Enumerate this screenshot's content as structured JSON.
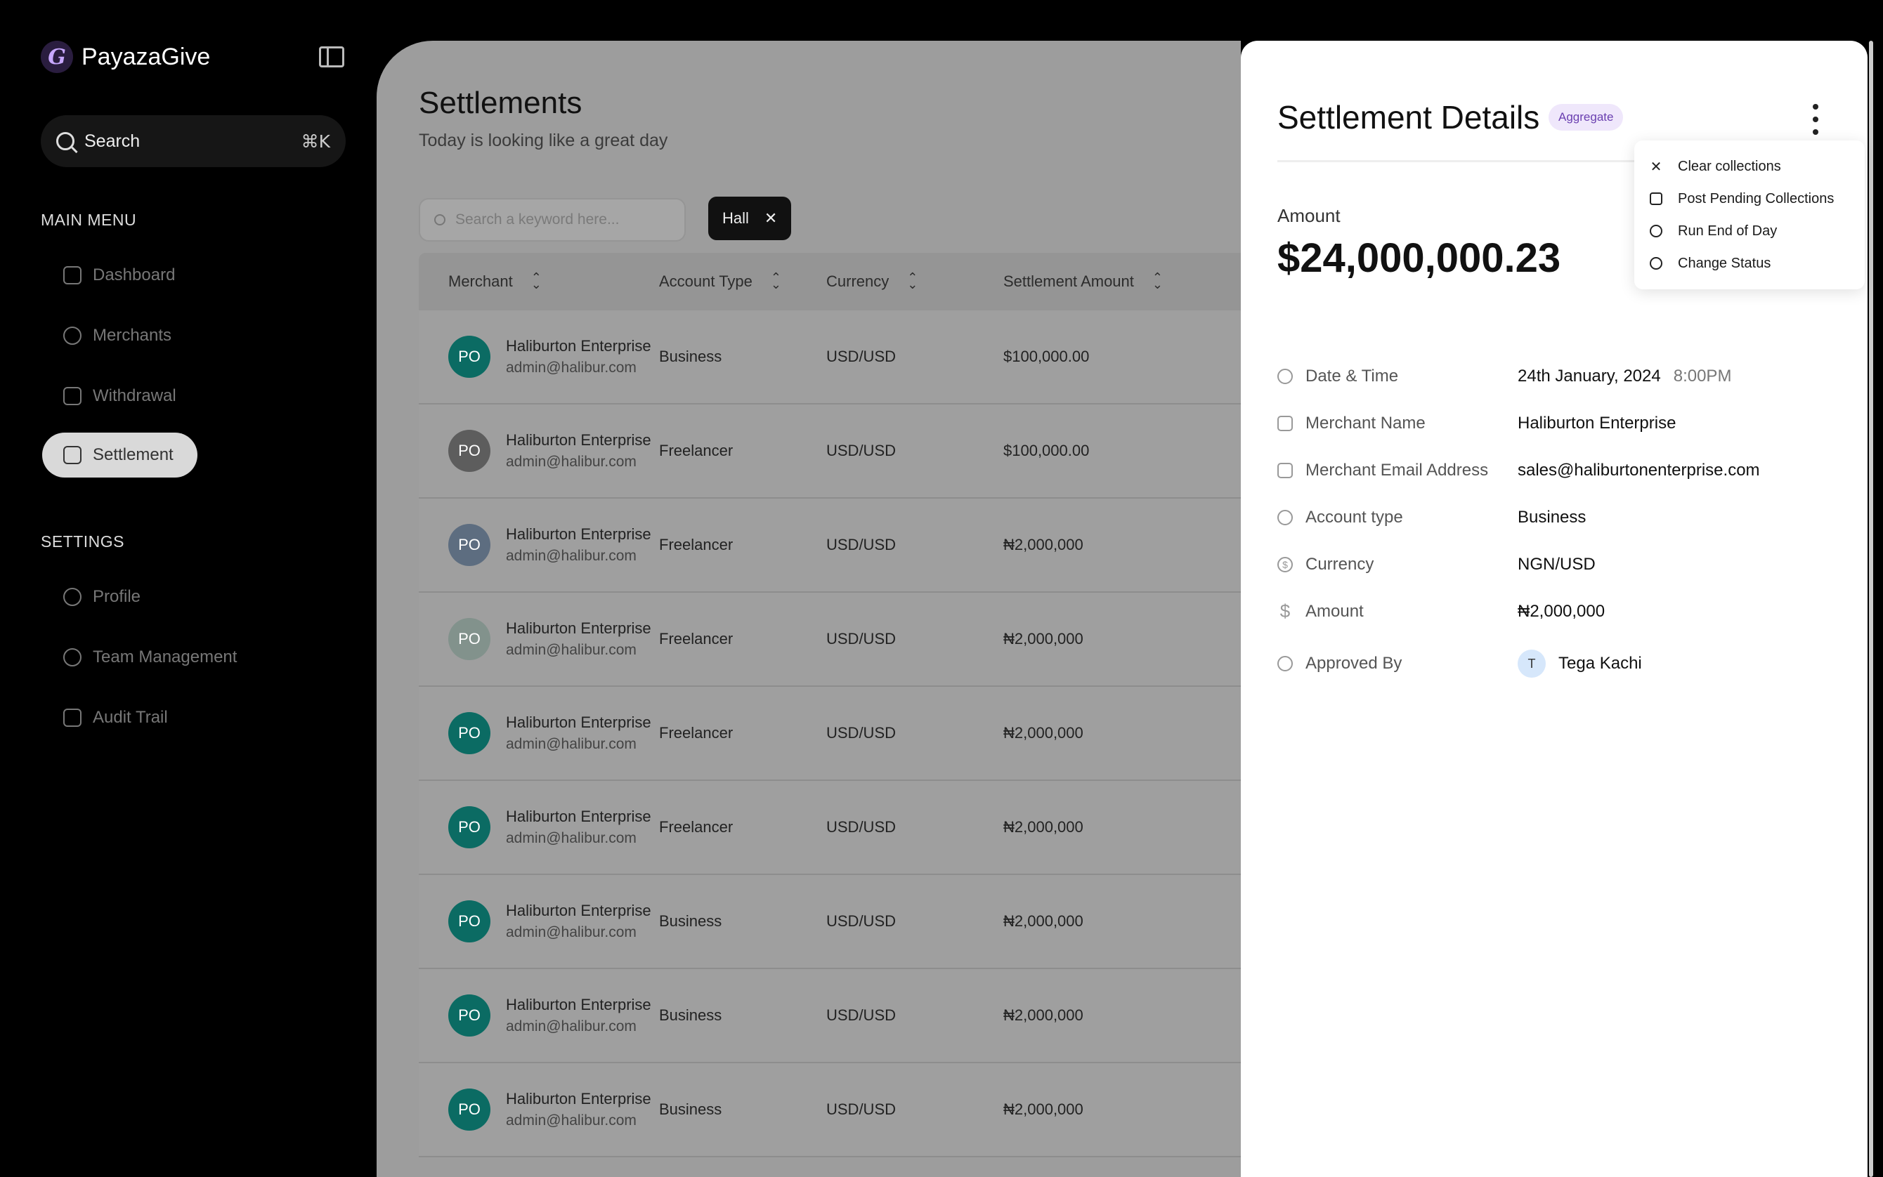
{
  "brand": {
    "name": "PayazaGive",
    "logo_letter": "G"
  },
  "sidebar": {
    "search_label": "Search",
    "search_shortcut": "⌘K",
    "main_menu_title": "MAIN MENU",
    "main_items": [
      {
        "label": "Dashboard",
        "icon": "grid-icon"
      },
      {
        "label": "Merchants",
        "icon": "users-icon"
      },
      {
        "label": "Withdrawal",
        "icon": "wallet-icon"
      },
      {
        "label": "Settlement",
        "icon": "settlement-icon",
        "active": true
      }
    ],
    "settings_title": "SETTINGS",
    "settings_items": [
      {
        "label": "Profile",
        "icon": "user-icon"
      },
      {
        "label": "Team Management",
        "icon": "team-icon"
      },
      {
        "label": "Audit Trail",
        "icon": "audit-icon"
      }
    ]
  },
  "main": {
    "title": "Settlements",
    "subtitle": "Today is looking like a great day",
    "search_placeholder": "Search a keyword here...",
    "filter_chip": "Hall",
    "columns": [
      "Merchant",
      "Account Type",
      "Currency",
      "Settlement Amount"
    ],
    "rows": [
      {
        "initials": "PO",
        "avatar_color": "#0b6b63",
        "name": "Haliburton Enterprise",
        "email": "admin@halibur.com",
        "type": "Business",
        "currency": "USD/USD",
        "amount": "$100,000.00",
        "status_color": "#8e8e8e"
      },
      {
        "initials": "PO",
        "avatar_color": "#5d5d5d",
        "name": "Haliburton Enterprise",
        "email": "admin@halibur.com",
        "type": "Freelancer",
        "currency": "USD/USD",
        "amount": "$100,000.00",
        "status_color": "#a89570"
      },
      {
        "initials": "PO",
        "avatar_color": "#5d6d80",
        "name": "Haliburton Enterprise",
        "email": "admin@halibur.com",
        "type": "Freelancer",
        "currency": "USD/USD",
        "amount": "₦2,000,000",
        "status_color": "#8c8ea6"
      },
      {
        "initials": "PO",
        "avatar_color": "#82928c",
        "name": "Haliburton Enterprise",
        "email": "admin@halibur.com",
        "type": "Freelancer",
        "currency": "USD/USD",
        "amount": "₦2,000,000",
        "status_color": "#88a088"
      },
      {
        "initials": "PO",
        "avatar_color": "#0b6b63",
        "name": "Haliburton Enterprise",
        "email": "admin@halibur.com",
        "type": "Freelancer",
        "currency": "USD/USD",
        "amount": "₦2,000,000",
        "status_color": "#8e8e8e"
      },
      {
        "initials": "PO",
        "avatar_color": "#0b6b63",
        "name": "Haliburton Enterprise",
        "email": "admin@halibur.com",
        "type": "Freelancer",
        "currency": "USD/USD",
        "amount": "₦2,000,000",
        "status_color": "#a89570"
      },
      {
        "initials": "PO",
        "avatar_color": "#0b6b63",
        "name": "Haliburton Enterprise",
        "email": "admin@halibur.com",
        "type": "Business",
        "currency": "USD/USD",
        "amount": "₦2,000,000",
        "status_color": "#a89570"
      },
      {
        "initials": "PO",
        "avatar_color": "#0b6b63",
        "name": "Haliburton Enterprise",
        "email": "admin@halibur.com",
        "type": "Business",
        "currency": "USD/USD",
        "amount": "₦2,000,000",
        "status_color": "#a89570"
      },
      {
        "initials": "PO",
        "avatar_color": "#0b6b63",
        "name": "Haliburton Enterprise",
        "email": "admin@halibur.com",
        "type": "Business",
        "currency": "USD/USD",
        "amount": "₦2,000,000",
        "status_color": "#a89570"
      }
    ]
  },
  "panel": {
    "title": "Settlement Details",
    "badge": "Aggregate",
    "amount_label": "Amount",
    "amount": "$24,000,000.23",
    "menu": [
      {
        "label": "Clear collections",
        "icon": "close-icon"
      },
      {
        "label": "Post Pending Collections",
        "icon": "post-icon"
      },
      {
        "label": "Run End of Day",
        "icon": "run-icon"
      },
      {
        "label": "Change Status",
        "icon": "status-icon"
      }
    ],
    "details": {
      "date_label": "Date & Time",
      "date": "24th January, 2024",
      "time": "8:00PM",
      "merchant_label": "Merchant Name",
      "merchant": "Haliburton Enterprise",
      "email_label": "Merchant Email Address",
      "email": "sales@haliburtonenterprise.com",
      "type_label": "Account type",
      "type": "Business",
      "currency_label": "Currency",
      "currency": "NGN/USD",
      "amount_label": "Amount",
      "amount": "₦2,000,000",
      "approved_label": "Approved By",
      "approver_initial": "T",
      "approver": "Tega Kachi"
    }
  }
}
